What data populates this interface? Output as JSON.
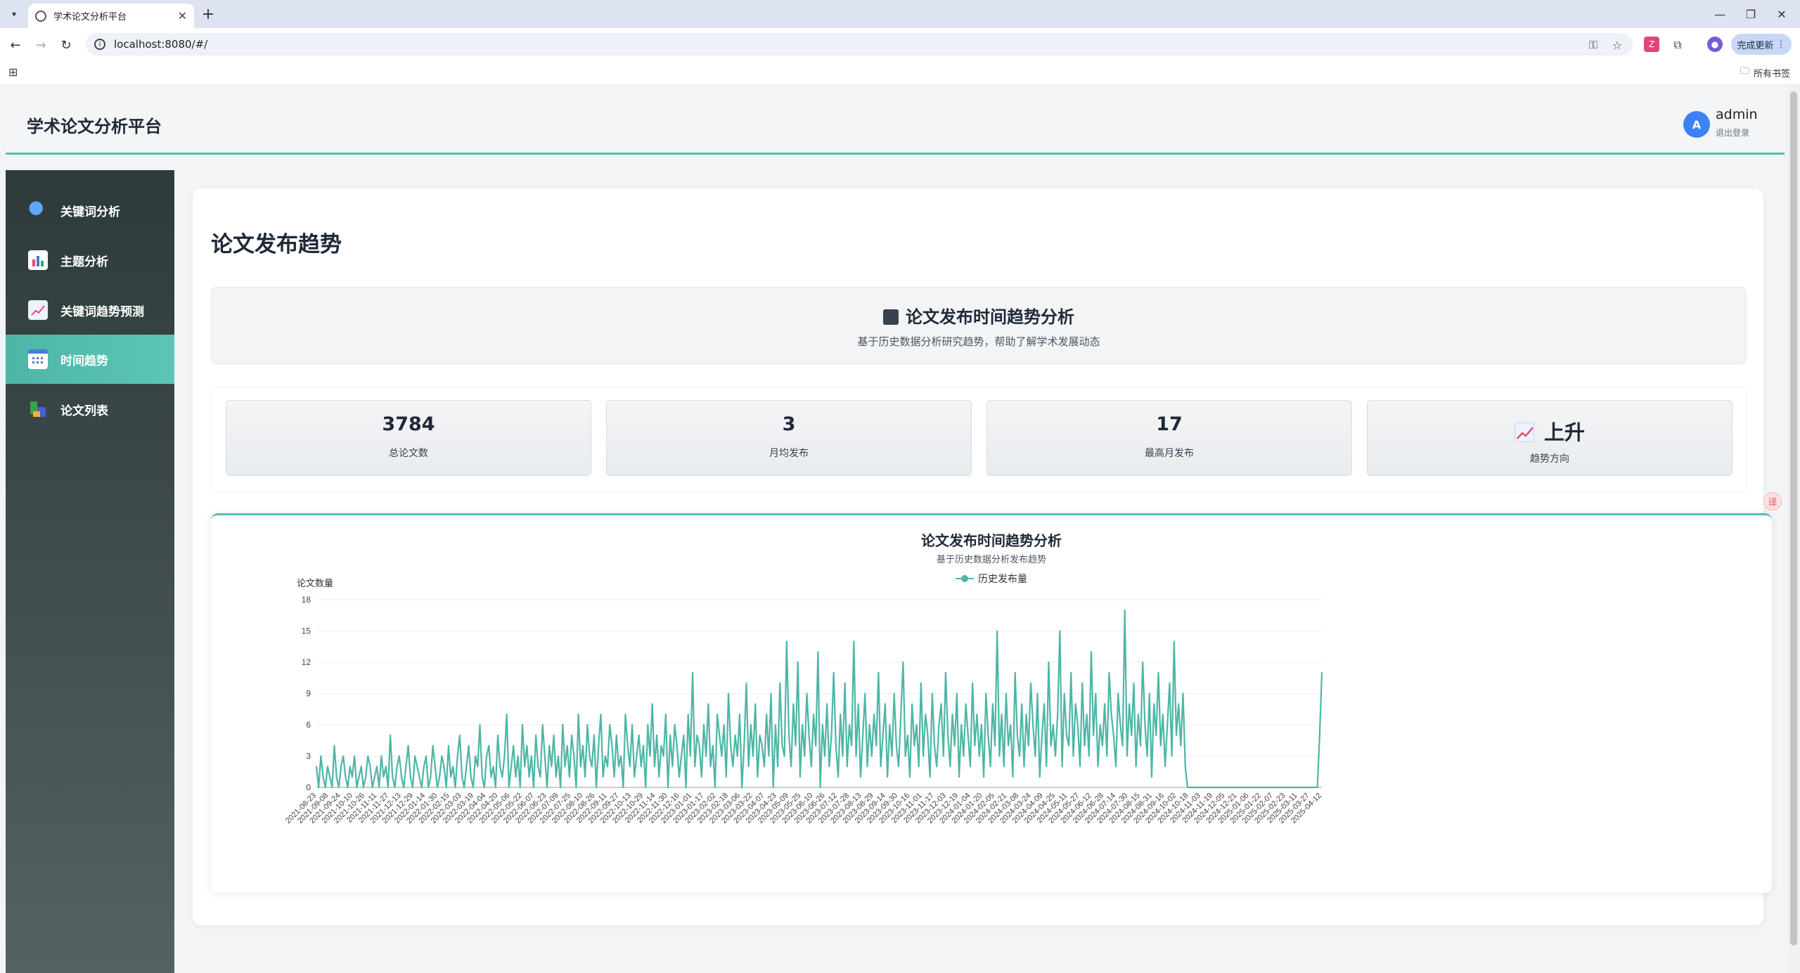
{
  "browser": {
    "tab_title": "学术论文分析平台",
    "url": "localhost:8080/#/",
    "update_label": "完成更新",
    "bookmarks_all": "所有书签"
  },
  "app": {
    "title": "学术论文分析平台",
    "user": {
      "avatar_letter": "A",
      "name": "admin",
      "logout": "退出登录"
    }
  },
  "sidebar": {
    "items": [
      {
        "label": "关键词分析",
        "icon": "search-icon",
        "active": false
      },
      {
        "label": "主题分析",
        "icon": "bar-chart-icon",
        "active": false
      },
      {
        "label": "关键词趋势预测",
        "icon": "trend-chart-icon",
        "active": false
      },
      {
        "label": "时间趋势",
        "icon": "calendar-icon",
        "active": true
      },
      {
        "label": "论文列表",
        "icon": "books-icon",
        "active": false
      }
    ]
  },
  "main": {
    "page_title": "论文发布趋势",
    "banner": {
      "title": "论文发布时间趋势分析",
      "subtitle": "基于历史数据分析研究趋势，帮助了解学术发展动态"
    },
    "stats": [
      {
        "value": "3784",
        "label": "总论文数"
      },
      {
        "value": "3",
        "label": "月均发布"
      },
      {
        "value": "17",
        "label": "最高月发布"
      },
      {
        "value": "上升",
        "label": "趋势方向",
        "icon": "chart-up-icon"
      }
    ]
  },
  "chart_data": {
    "type": "line",
    "title": "论文发布时间趋势分析",
    "subtitle": "基于历史数据分析发布趋势",
    "ylabel": "论文数量",
    "ylim": [
      0,
      18
    ],
    "yticks": [
      0,
      3,
      6,
      9,
      12,
      15,
      18
    ],
    "legend": "历史发布量",
    "color": "#4db6a6",
    "x_tick_labels": [
      "2021-08-23",
      "2021-09-08",
      "2021-09-24",
      "2021-10-10",
      "2021-10-26",
      "2021-11-11",
      "2021-11-27",
      "2021-12-13",
      "2021-12-29",
      "2022-01-14",
      "2022-01-30",
      "2022-02-15",
      "2022-03-03",
      "2022-03-19",
      "2022-04-04",
      "2022-04-20",
      "2022-05-06",
      "2022-05-22",
      "2022-06-07",
      "2022-06-23",
      "2022-07-09",
      "2022-07-25",
      "2022-08-10",
      "2022-08-26",
      "2022-09-11",
      "2022-09-27",
      "2022-10-13",
      "2022-10-29",
      "2022-11-14",
      "2022-11-30",
      "2022-12-16",
      "2023-01-01",
      "2023-01-17",
      "2023-02-02",
      "2023-02-18",
      "2023-03-06",
      "2023-03-22",
      "2023-04-07",
      "2023-04-23",
      "2023-05-09",
      "2023-05-25",
      "2023-06-10",
      "2023-06-26",
      "2023-07-12",
      "2023-07-28",
      "2023-08-13",
      "2023-08-29",
      "2023-09-14",
      "2023-09-30",
      "2023-10-16",
      "2023-11-01",
      "2023-11-17",
      "2023-12-03",
      "2023-12-19",
      "2024-01-04",
      "2024-01-20",
      "2024-02-05",
      "2024-02-21",
      "2024-03-08",
      "2024-03-24",
      "2024-04-09",
      "2024-04-25",
      "2024-05-11",
      "2024-05-27",
      "2024-06-12",
      "2024-06-28",
      "2024-07-14",
      "2024-07-30",
      "2024-08-15",
      "2024-08-31",
      "2024-09-16",
      "2024-10-02",
      "2024-10-18",
      "2024-11-03",
      "2024-11-19",
      "2024-12-05",
      "2024-12-21",
      "2025-01-06",
      "2025-01-22",
      "2025-02-07",
      "2025-02-23",
      "2025-03-11",
      "2025-03-27",
      "2025-04-12"
    ],
    "series": [
      {
        "name": "历史发布量",
        "values": [
          2,
          0,
          3,
          1,
          0,
          2,
          1,
          0,
          4,
          1,
          0,
          2,
          3,
          1,
          0,
          2,
          1,
          3,
          0,
          1,
          2,
          0,
          1,
          3,
          2,
          0,
          1,
          2,
          0,
          3,
          1,
          2,
          0,
          5,
          1,
          0,
          2,
          3,
          1,
          0,
          2,
          4,
          1,
          0,
          3,
          2,
          1,
          0,
          2,
          3,
          0,
          1,
          4,
          2,
          0,
          1,
          3,
          2,
          0,
          4,
          1,
          2,
          0,
          3,
          5,
          1,
          0,
          2,
          4,
          1,
          0,
          3,
          2,
          6,
          1,
          0,
          3,
          4,
          1,
          2,
          0,
          5,
          2,
          1,
          3,
          7,
          0,
          2,
          4,
          1,
          3,
          0,
          6,
          2,
          4,
          1,
          3,
          0,
          5,
          2,
          1,
          6,
          3,
          0,
          4,
          2,
          5,
          1,
          3,
          0,
          6,
          2,
          4,
          1,
          5,
          3,
          0,
          7,
          2,
          4,
          1,
          6,
          3,
          2,
          5,
          0,
          4,
          7,
          1,
          3,
          2,
          6,
          4,
          1,
          5,
          2,
          3,
          0,
          7,
          4,
          2,
          6,
          1,
          3,
          5,
          2,
          4,
          0,
          6,
          3,
          8,
          2,
          5,
          1,
          4,
          3,
          7,
          0,
          5,
          2,
          6,
          4,
          1,
          3,
          5,
          0,
          7,
          3,
          11,
          2,
          5,
          4,
          1,
          6,
          3,
          8,
          2,
          4,
          0,
          7,
          5,
          3,
          6,
          1,
          9,
          4,
          2,
          5,
          3,
          7,
          0,
          4,
          10,
          2,
          6,
          3,
          8,
          1,
          5,
          4,
          2,
          7,
          3,
          9,
          0,
          6,
          2,
          10,
          4,
          3,
          14,
          5,
          2,
          8,
          4,
          12,
          1,
          6,
          3,
          9,
          5,
          2,
          7,
          4,
          13,
          0,
          6,
          3,
          8,
          2,
          5,
          11,
          4,
          1,
          7,
          3,
          10,
          2,
          6,
          4,
          14,
          3,
          8,
          1,
          5,
          9,
          2,
          6,
          3,
          7,
          4,
          11,
          2,
          5,
          8,
          1,
          6,
          3,
          9,
          4,
          2,
          7,
          12,
          3,
          5,
          1,
          8,
          4,
          6,
          2,
          10,
          3,
          7,
          5,
          1,
          9,
          4,
          2,
          6,
          8,
          3,
          11,
          5,
          2,
          7,
          4,
          9,
          1,
          6,
          3,
          8,
          5,
          2,
          10,
          4,
          7,
          3,
          6,
          1,
          9,
          5,
          2,
          8,
          4,
          15,
          3,
          7,
          2,
          9,
          4,
          6,
          1,
          11,
          5,
          3,
          8,
          2,
          7,
          4,
          10,
          6,
          3,
          9,
          1,
          5,
          8,
          2,
          12,
          4,
          6,
          3,
          7,
          15,
          2,
          9,
          5,
          4,
          11,
          3,
          8,
          6,
          2,
          10,
          4,
          7,
          3,
          13,
          5,
          9,
          2,
          6,
          4,
          8,
          3,
          11,
          7,
          5,
          2,
          9,
          6,
          4,
          17,
          3,
          8,
          5,
          10,
          2,
          7,
          4,
          12,
          6,
          3,
          9,
          1,
          8,
          5,
          11,
          4,
          7,
          2,
          6,
          10,
          3,
          14,
          5,
          8,
          4,
          9,
          2,
          0,
          0,
          0,
          0,
          0,
          0,
          0,
          0,
          0,
          0,
          0,
          0,
          0,
          0,
          0,
          0,
          0,
          0,
          0,
          0,
          0,
          0,
          0,
          0,
          0,
          0,
          0,
          0,
          0,
          0,
          0,
          0,
          0,
          0,
          0,
          0,
          0,
          0,
          0,
          0,
          0,
          0,
          0,
          0,
          0,
          0,
          0,
          0,
          0,
          0,
          0,
          0,
          0,
          0,
          0,
          0,
          0,
          0,
          0,
          5,
          11
        ]
      }
    ],
    "grid": true,
    "legend_position": "top-center"
  }
}
